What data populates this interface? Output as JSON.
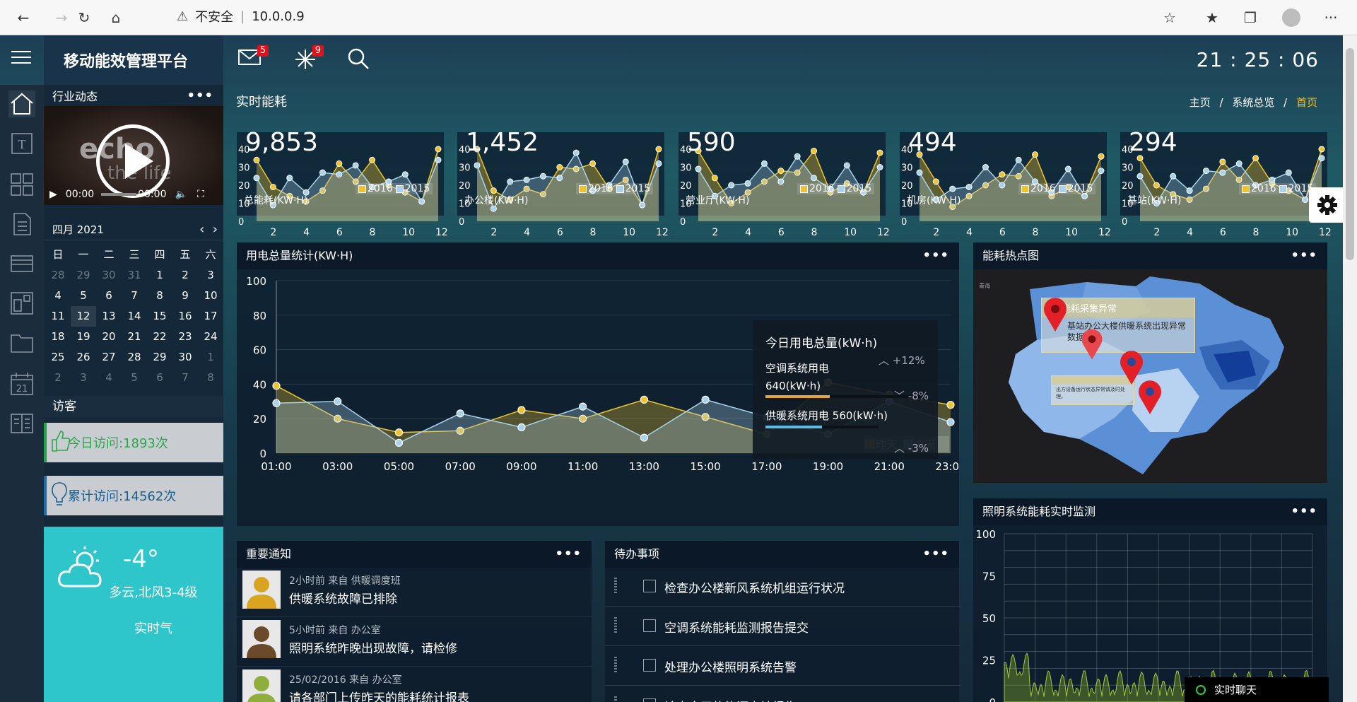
{
  "browser": {
    "security_label": "不安全",
    "url": "10.0.0.9"
  },
  "app": {
    "title": "移动能效管理平台",
    "mail_count": "5",
    "alert_count": "9",
    "clock": "21 : 25 : 06"
  },
  "sidebar": {
    "news_title": "行业动态",
    "video": {
      "caption_top": "echo",
      "caption_bottom": "the life",
      "current": "00:00",
      "duration": "00:00"
    },
    "calendar": {
      "month": "四月 2021",
      "weekdays": [
        "日",
        "一",
        "二",
        "三",
        "四",
        "五",
        "六"
      ],
      "days": [
        "28",
        "29",
        "30",
        "31",
        "1",
        "2",
        "3",
        "4",
        "5",
        "6",
        "7",
        "8",
        "9",
        "10",
        "11",
        "12",
        "13",
        "14",
        "15",
        "16",
        "17",
        "18",
        "19",
        "20",
        "21",
        "22",
        "23",
        "24",
        "25",
        "26",
        "27",
        "28",
        "29",
        "30",
        "1",
        "2",
        "3",
        "4",
        "5",
        "6",
        "7",
        "8"
      ]
    },
    "visitors_title": "访客",
    "today_visits": "今日访问:1893次",
    "total_visits": "累计访问:14562次",
    "weather": {
      "temp": "-4°",
      "desc": "多云,北风3-4级",
      "extra": "实时气"
    }
  },
  "page": {
    "title": "实时能耗",
    "breadcrumb": [
      "主页",
      "系统总览",
      "首页"
    ]
  },
  "kpis": [
    {
      "value": "9,853",
      "label": "总能耗(KW·H)"
    },
    {
      "value": "1,452",
      "label": "办公楼(KW·H)"
    },
    {
      "value": "590",
      "label": "营业厅(KW·H)"
    },
    {
      "value": "494",
      "label": "机房(KW·H)"
    },
    {
      "value": "294",
      "label": "基站(KW·H)"
    }
  ],
  "kpi_legend": [
    "2016",
    "2015"
  ],
  "panels": {
    "usage_title": "用电总量统计(KW·H)",
    "heatmap_title": "能耗热点图",
    "lighting_title": "照明系统能耗实时监测",
    "notice_title": "重要通知",
    "todo_title": "待办事项",
    "more": "•••"
  },
  "tooltip": {
    "title": "今日用电总量(kW·h)",
    "total_change": "+12%",
    "ac_label": "空调系统用电",
    "ac_value": "640(kW·h)",
    "ac_change": "-8%",
    "heat_label": "供暖系统用电",
    "heat_value": "560(kW·h)",
    "heat_change": "-3%"
  },
  "heatmap": {
    "corner": "青海",
    "alert_title": "能耗采集异常",
    "alert_text": "基站办公大楼供暖系统出现异常数据。",
    "alert2": "出方设备运行状态异常请及时处理。"
  },
  "notices": [
    {
      "meta": "2小时前 来自 供暖调度班",
      "title": "供暖系统故障已排除"
    },
    {
      "meta": "5小时前 来自 办公室",
      "title": "照明系统昨晚出现故障，请检修"
    },
    {
      "meta": "25/02/2016 来自 办公室",
      "title": "请各部门上传昨天的能耗统计报表"
    }
  ],
  "todos": [
    "检查办公楼新风系统机组运行状况",
    "空调系统能耗监测报告提交",
    "处理办公楼照明系统告警",
    "输出今天的能源审计报告"
  ],
  "chat": {
    "label": "实时聊天"
  },
  "colors": {
    "yesterday": "#f0c22c",
    "today": "#a9d2ec",
    "accent": "#f6c21a"
  },
  "chart_data": [
    {
      "type": "line",
      "title": "用电总量统计(KW·H)",
      "categories": [
        "01:00",
        "02:00",
        "03:00",
        "04:00",
        "05:00",
        "06:00",
        "07:00",
        "08:00",
        "09:00",
        "10:00",
        "11:00",
        "12:00",
        "13:00",
        "14:00",
        "15:00",
        "16:00",
        "17:00",
        "18:00",
        "19:00",
        "20:00",
        "21:00",
        "22:00",
        "23:00"
      ],
      "x_tick_labels": [
        "01:00",
        "03:00",
        "05:00",
        "07:00",
        "09:00",
        "11:00",
        "13:00",
        "15:00",
        "17:00",
        "19:00",
        "21:00",
        "23:00"
      ],
      "ylim": [
        0,
        100
      ],
      "y_ticks": [
        0,
        20,
        40,
        60,
        80,
        100
      ],
      "series": [
        {
          "name": "昨天",
          "values": [
            39,
            null,
            20,
            null,
            12,
            null,
            13,
            null,
            25,
            null,
            20,
            null,
            31,
            null,
            21,
            null,
            11,
            null,
            41,
            null,
            34,
            null,
            28
          ]
        },
        {
          "name": "今天",
          "values": [
            29,
            null,
            30,
            null,
            6,
            null,
            23,
            null,
            15,
            null,
            27,
            null,
            9,
            null,
            31,
            null,
            21,
            null,
            11,
            null,
            30,
            null,
            18
          ]
        }
      ]
    },
    {
      "type": "line",
      "title": "照明系统能耗实时监测",
      "ylim": [
        0,
        100
      ],
      "y_ticks": [
        0,
        25,
        50,
        75,
        100
      ]
    },
    {
      "type": "area",
      "title": "总能耗(KW·H)",
      "x": [
        1,
        2,
        3,
        4,
        5,
        6,
        7,
        8,
        9,
        10,
        11,
        12
      ],
      "x_tick_labels": [
        "2",
        "4",
        "6",
        "8",
        "10",
        "12"
      ],
      "y_ticks": [
        0,
        10,
        20,
        30,
        40
      ],
      "series": [
        {
          "name": "2016",
          "values": [
            38,
            20,
            12,
            15,
            18,
            30,
            26,
            35,
            18,
            20,
            12,
            40
          ]
        },
        {
          "name": "2015",
          "values": [
            28,
            10,
            22,
            20,
            28,
            24,
            35,
            20,
            20,
            30,
            12,
            32
          ]
        }
      ]
    }
  ]
}
